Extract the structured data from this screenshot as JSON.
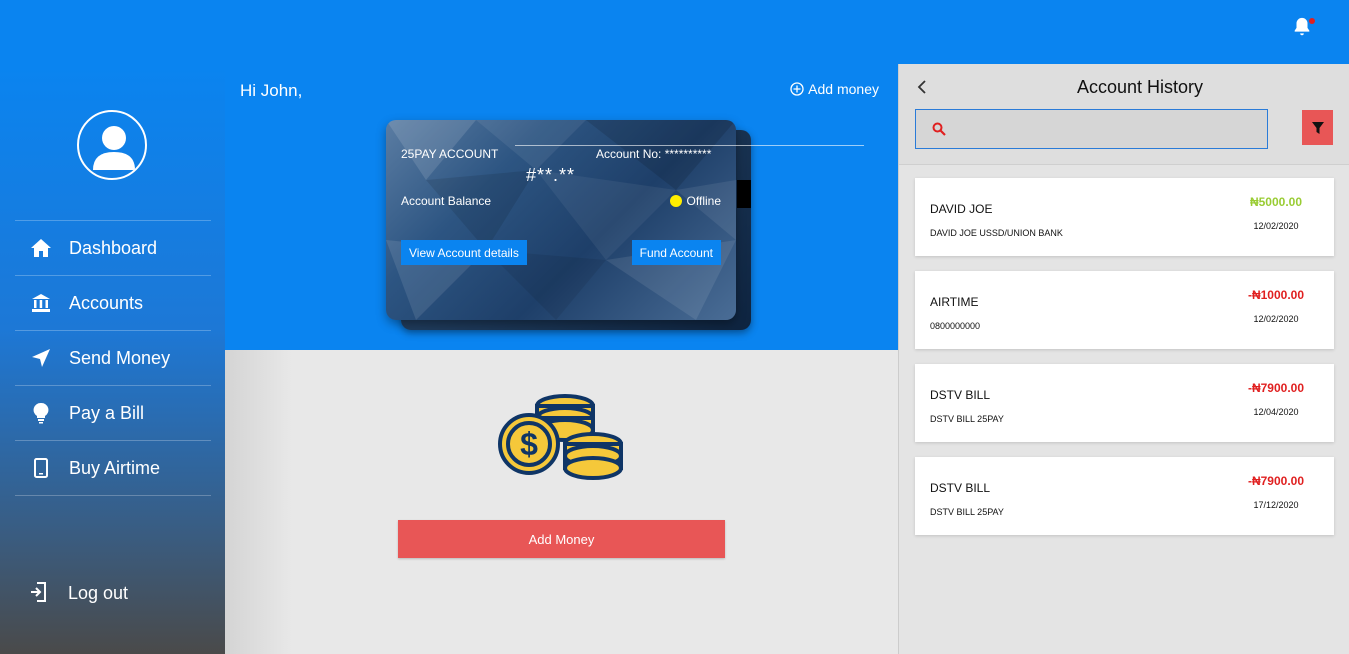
{
  "header": {
    "notification_icon": "bell-icon"
  },
  "sidebar": {
    "avatar_icon": "user-icon",
    "items": [
      {
        "label": "Dashboard",
        "icon": "home-icon"
      },
      {
        "label": "Accounts",
        "icon": "bank-icon"
      },
      {
        "label": "Send Money",
        "icon": "send-icon"
      },
      {
        "label": "Pay a Bill",
        "icon": "lightbulb-icon"
      },
      {
        "label": "Buy Airtime",
        "icon": "mobile-icon"
      }
    ],
    "logout": {
      "label": "Log out",
      "icon": "logout-icon"
    }
  },
  "main": {
    "greeting": "Hi John,",
    "add_money_link": "Add money",
    "card": {
      "account_type": "25PAY ACCOUNT",
      "account_no": "Account No: **********",
      "balance": "#**.**",
      "balance_label": "Account Balance",
      "status": "Offline",
      "status_color": "#ffee00",
      "view_button": "View Account details",
      "fund_button": "Fund Account"
    },
    "add_money_button": "Add Money"
  },
  "history": {
    "title": "Account History",
    "search_placeholder": "",
    "transactions": [
      {
        "name": "DAVID JOE",
        "description": "DAVID JOE USSD/UNION BANK",
        "amount": "₦5000.00",
        "date": "12/02/2020",
        "type": "credit"
      },
      {
        "name": "AIRTIME",
        "description": "0800000000",
        "amount": "-₦1000.00",
        "date": "12/02/2020",
        "type": "debit"
      },
      {
        "name": "DSTV BILL",
        "description": "DSTV BILL 25PAY",
        "amount": "-₦7900.00",
        "date": "12/04/2020",
        "type": "debit"
      },
      {
        "name": "DSTV BILL",
        "description": "DSTV BILL 25PAY",
        "amount": "-₦7900.00",
        "date": "17/12/2020",
        "type": "debit"
      }
    ]
  },
  "colors": {
    "primary": "#0a84f0",
    "accent_red": "#e85656",
    "credit": "#99cc33",
    "debit": "#e02020"
  }
}
